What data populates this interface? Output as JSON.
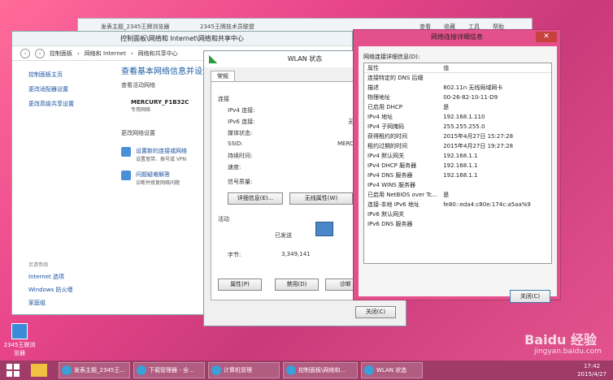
{
  "desktop": {
    "icon_label": "2345王牌浏览器"
  },
  "browser": {
    "tab1": "发表主题_2345王牌浏览器",
    "tab2": "2345王牌技术员联盟",
    "menu": [
      "查看",
      "收藏",
      "工具",
      "帮助"
    ]
  },
  "control_panel": {
    "title": "控制面板\\网络和 Internet\\网络和共享中心",
    "breadcrumb": [
      "控制面板",
      "网络和 Internet",
      "网络和共享中心"
    ],
    "side_links": [
      "控制面板主页",
      "更改适配器设置",
      "更改高级共享设置"
    ],
    "see_also_header": "另请参阅",
    "see_also_links": [
      "Internet 选项",
      "Windows 防火墙",
      "家庭组"
    ],
    "heading": "查看基本网络信息并设置",
    "active_label": "查看活动网络",
    "network_name": "MERCURY_F1B32C",
    "network_type": "专用网络",
    "change_label": "更改网络设置",
    "item1_title": "设置新的连接或网络",
    "item1_desc": "设置宽带、拨号或 VPN",
    "item2_title": "问题疑难解答",
    "item2_desc": "诊断并修复网络问题"
  },
  "wlan": {
    "title": "WLAN 状态",
    "tab": "常规",
    "conn_label": "连接",
    "ipv4": "IPv4 连接:",
    "ipv6": "IPv6 连接:",
    "ipv6_val": "无",
    "media": "媒体状态:",
    "ssid": "SSID:",
    "ssid_val": "MERC",
    "duration": "持续时间:",
    "speed": "速度:",
    "quality": "信号质量:",
    "details_btn": "详细信息(E)...",
    "wireless_btn": "无线属性(W)",
    "activity_label": "活动",
    "sent": "已发送",
    "bytes": "字节:",
    "bytes_val": "3,349,141",
    "props_btn": "属性(P)",
    "disable_btn": "禁用(D)",
    "diag_btn": "诊断",
    "close_btn": "关闭(C)"
  },
  "details": {
    "title": "网络连接详细信息",
    "label": "网络连接详细信息(D):",
    "col1": "属性",
    "col2": "值",
    "rows": [
      [
        "连接特定的 DNS 后缀",
        ""
      ],
      [
        "描述",
        "802.11n 无线局域网卡"
      ],
      [
        "物理地址",
        "00-26-82-10-11-D9"
      ],
      [
        "已启用 DHCP",
        "是"
      ],
      [
        "IPv4 地址",
        "192.168.1.110"
      ],
      [
        "IPv4 子网掩码",
        "255.255.255.0"
      ],
      [
        "获得租约的时间",
        "2015年4月27日 15:27:28"
      ],
      [
        "租约过期的时间",
        "2015年4月27日 19:27:28"
      ],
      [
        "IPv4 默认网关",
        "192.168.1.1"
      ],
      [
        "IPv4 DHCP 服务器",
        "192.168.1.1"
      ],
      [
        "IPv4 DNS 服务器",
        "192.168.1.1"
      ],
      [
        "IPv4 WINS 服务器",
        ""
      ],
      [
        "已启用 NetBIOS over Tc...",
        "是"
      ],
      [
        "连接-本地 IPv6 地址",
        "fe80::eda4:c80e:174c:a5aa%9"
      ],
      [
        "IPv6 默认网关",
        ""
      ],
      [
        "IPv6 DNS 服务器",
        ""
      ]
    ],
    "close_btn": "关闭(C)"
  },
  "taskbar": {
    "items": [
      "发表主题_2345王...",
      "下载管理器 - 全...",
      "计算机管理",
      "控制面板\\网络和...",
      "WLAN 状态"
    ],
    "time": "17:42",
    "date": "2015/4/27"
  },
  "watermark": {
    "brand": "Baidu 经验",
    "url": "jingyan.baidu.com"
  }
}
